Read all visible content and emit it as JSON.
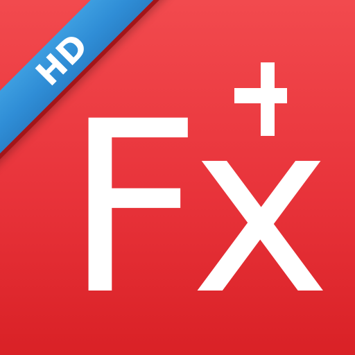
{
  "app_icon": {
    "ribbon_label": "HD",
    "main_label": "Fx",
    "plus_icon": "plus-icon",
    "colors": {
      "background": "#e8333a",
      "ribbon": "#2f8dd6",
      "foreground": "#ffffff"
    }
  }
}
